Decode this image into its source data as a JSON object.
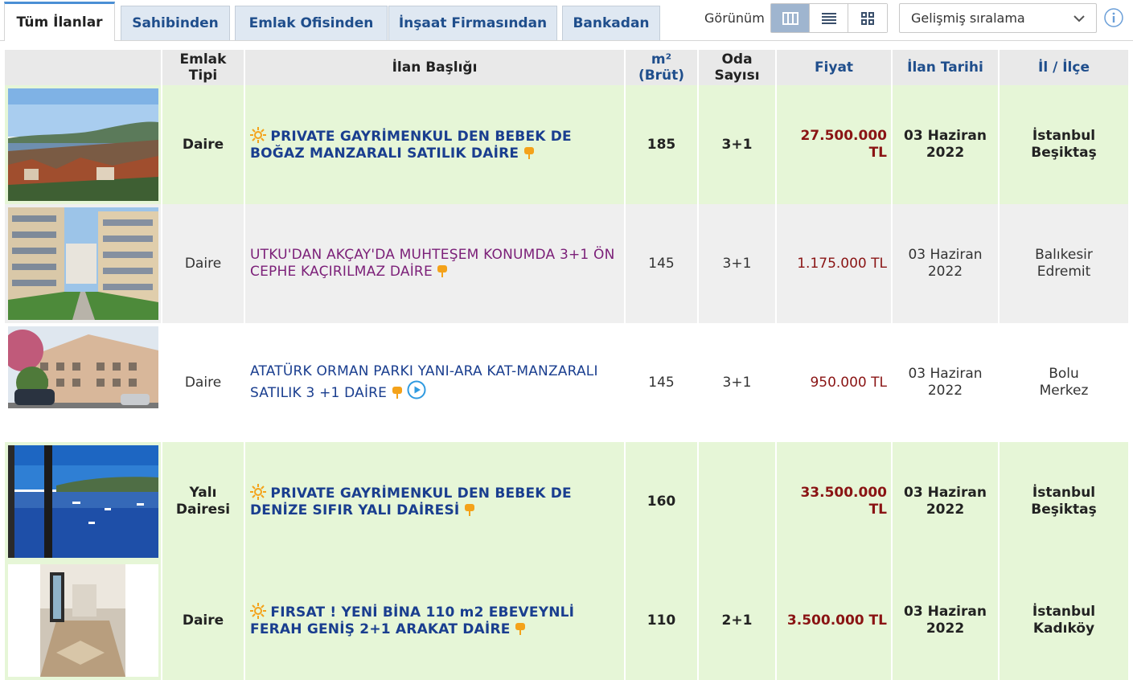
{
  "tabs": [
    {
      "label": "Tüm İlanlar",
      "active": true
    },
    {
      "label": "Sahibinden",
      "active": false
    },
    {
      "label": "Emlak Ofisinden",
      "active": false
    },
    {
      "label": "İnşaat Firmasından",
      "active": false
    },
    {
      "label": "Bankadan",
      "active": false
    }
  ],
  "view": {
    "label": "Görünüm",
    "options": [
      "table-view-icon",
      "list-view-icon",
      "grid-view-icon"
    ],
    "active": "table-view-icon"
  },
  "sort": {
    "label": "Gelişmiş sıralama"
  },
  "table": {
    "headers": {
      "photo": "",
      "type": "Emlak Tipi",
      "title": "İlan Başlığı",
      "area": "m² (Brüt)",
      "rooms": "Oda Sayısı",
      "price": "Fiyat",
      "date": "İlan Tarihi",
      "location": "İl / İlçe"
    },
    "rows": [
      {
        "type": "Daire",
        "title": "PRIVATE GAYRİMENKUL DEN BEBEK DE BOĞAZ MANZARALI SATILIK DAİRE",
        "area": "185",
        "rooms": "3+1",
        "price": "27.500.000 TL",
        "date_day": "03 Haziran",
        "date_year": "2022",
        "city": "İstanbul",
        "district": "Beşiktaş",
        "highlighted": true,
        "featured_icon": "sun-icon",
        "photo": "bosphorus-view-photo"
      },
      {
        "type": "Daire",
        "title": "UTKU'DAN AKÇAY'DA MUHTEŞEM KONUMDA 3+1 ÖN CEPHE KAÇIRILMAZ DAİRE",
        "area": "145",
        "rooms": "3+1",
        "price": "1.175.000 TL",
        "date_day": "03 Haziran",
        "date_year": "2022",
        "city": "Balıkesir",
        "district": "Edremit",
        "highlighted": false,
        "photo": "apartment-courtyard-photo"
      },
      {
        "type": "Daire",
        "title": "ATATÜRK ORMAN PARKI YANI-ARA KAT-MANZARALI SATILIK 3 +1 DAİRE",
        "area": "145",
        "rooms": "3+1",
        "price": "950.000 TL",
        "date_day": "03 Haziran",
        "date_year": "2022",
        "city": "Bolu",
        "district": "Merkez",
        "highlighted": false,
        "has_video": true,
        "photo": "apartment-building-photo"
      },
      {
        "type": "Yalı Dairesi",
        "title": "PRIVATE GAYRİMENKUL DEN BEBEK DE DENİZE SIFIR YALI DAİRESİ",
        "area": "160",
        "rooms": "",
        "price": "33.500.000 TL",
        "date_day": "03 Haziran",
        "date_year": "2022",
        "city": "İstanbul",
        "district": "Beşiktaş",
        "highlighted": true,
        "featured_icon": "sun-icon",
        "photo": "sea-view-photo"
      },
      {
        "type": "Daire",
        "title": "FIRSAT ! YENİ BİNA 110 m2 EBEVEYNLİ FERAH GENİŞ 2+1 ARAKAT DAİRE",
        "area": "110",
        "rooms": "2+1",
        "price": "3.500.000 TL",
        "date_day": "03 Haziran",
        "date_year": "2022",
        "city": "İstanbul",
        "district": "Kadıköy",
        "highlighted": true,
        "featured_icon": "sun-icon",
        "photo": "empty-room-photo"
      }
    ]
  },
  "colors": {
    "tab_bg": "#dfe8f2",
    "tab_text": "#1f4e8c",
    "highlight_row": "#e6f6d7",
    "gray_row": "#efefef",
    "price": "#8a1414",
    "title_blue": "#1a3e8f",
    "title_purple": "#7b1f78",
    "pin_orange": "#f4a21a"
  }
}
